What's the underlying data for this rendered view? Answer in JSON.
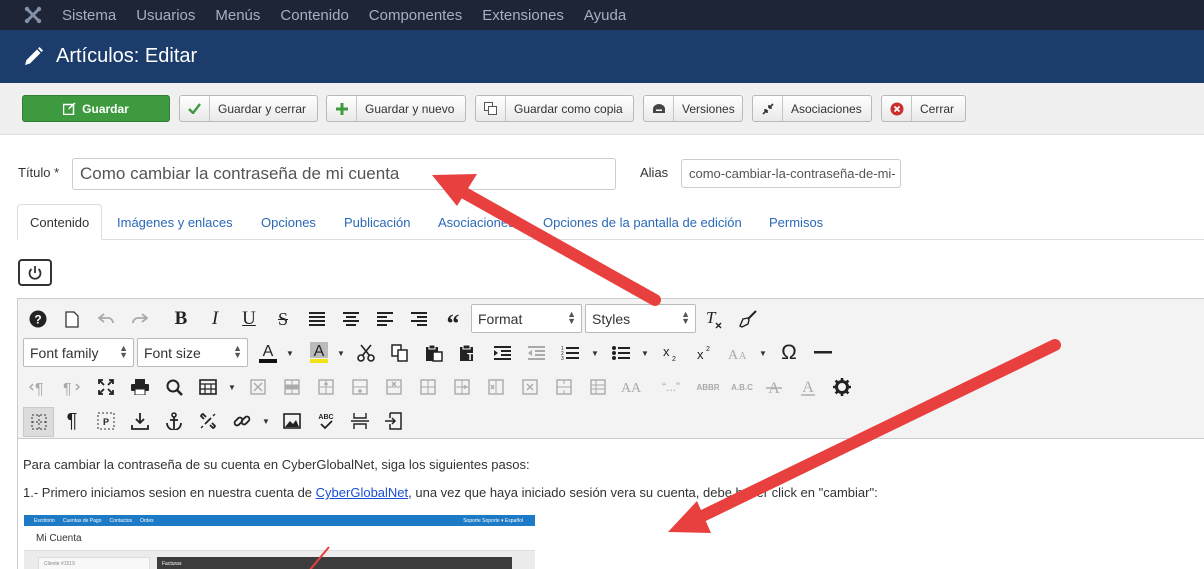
{
  "topbar": {
    "menu": [
      "Sistema",
      "Usuarios",
      "Menús",
      "Contenido",
      "Componentes",
      "Extensiones",
      "Ayuda"
    ]
  },
  "header": {
    "title": "Artículos: Editar"
  },
  "toolbar": {
    "save": "Guardar",
    "save_close": "Guardar y cerrar",
    "save_new": "Guardar y nuevo",
    "save_copy": "Guardar como copia",
    "versions": "Versiones",
    "associations": "Asociaciones",
    "close": "Cerrar"
  },
  "form": {
    "title_label": "Título",
    "required_mark": "*",
    "title_value": "Como cambiar la contraseña de mi cuenta",
    "alias_label": "Alias",
    "alias_value": "como-cambiar-la-contraseña-de-mi-"
  },
  "tabs": [
    "Contenido",
    "Imágenes y enlaces",
    "Opciones",
    "Publicación",
    "Asociaciones",
    "Opciones de la pantalla de edición",
    "Permisos"
  ],
  "editor": {
    "format_select": "Format",
    "styles_select": "Styles",
    "font_family_select": "Font family",
    "font_size_select": "Font size",
    "bold": "B",
    "italic": "I",
    "underline": "U",
    "strike": "S",
    "omega": "Ω",
    "quote": "“...”",
    "abbr": "ABBR",
    "abc": "A.B.C",
    "pilcrow": "¶",
    "content": {
      "p1": "Para cambiar la contraseña de su cuenta en CyberGlobalNet, siga los siguientes pasos:",
      "p2_before": "1.- Primero iniciamos sesion en nuestra cuenta de ",
      "p2_link": "CyberGlobalNet",
      "p2_after": ", una vez que haya iniciado sesión vera su cuenta, debe hacer click en \"cambiar\":"
    },
    "embedded_screenshot": {
      "nav": [
        "Escritorio",
        "Cuentas de Pago",
        "Contactos",
        "Ordes"
      ],
      "nav_right": "Soporte Soporte ▾ Español",
      "title": "Mi Cuenta",
      "client": "Cliente #1519",
      "panel": "Facturas"
    }
  },
  "colors": {
    "topbar": "#1d2536",
    "header": "#1c3d6b",
    "save": "#3d9a3f",
    "link": "#2a69b8",
    "annotation_arrow": "#e8403f"
  }
}
